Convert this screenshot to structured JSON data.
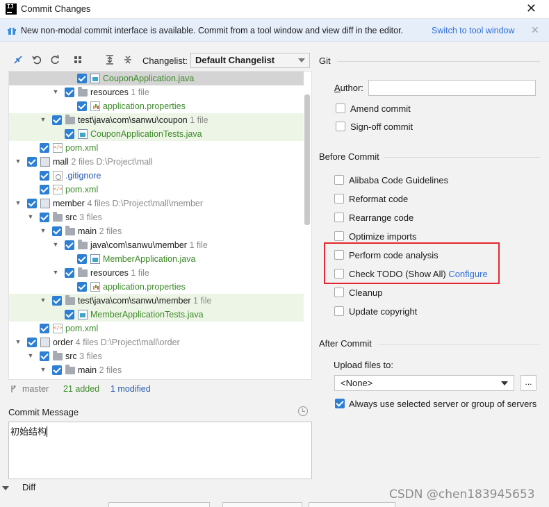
{
  "window": {
    "title": "Commit Changes",
    "logo": "IJ"
  },
  "banner": {
    "text": "New non-modal commit interface is available. Commit from a tool window and view diff in the editor.",
    "link": "Switch to tool window"
  },
  "toolbar": {
    "changelist_label": "Changelist:",
    "changelist_value": "Default Changelist",
    "icons": [
      "diff-arrows-icon",
      "undo-icon",
      "refresh-icon",
      "group-by-icon",
      "expand-all-icon",
      "collapse-all-icon"
    ]
  },
  "tree": [
    {
      "name": "CouponApplication.java",
      "meta": "",
      "type": "java",
      "color": "green"
    },
    {
      "name": "resources",
      "meta": "1 file",
      "type": "folder",
      "color": "normal"
    },
    {
      "name": "application.properties",
      "meta": "",
      "type": "props",
      "color": "green"
    },
    {
      "name": "test\\java\\com\\sanwu\\coupon",
      "meta": "1 file",
      "type": "folder",
      "color": "normal"
    },
    {
      "name": "CouponApplicationTests.java",
      "meta": "",
      "type": "java",
      "color": "green"
    },
    {
      "name": "pom.xml",
      "meta": "",
      "type": "xml",
      "color": "green"
    },
    {
      "name": "mall",
      "meta": "2 files  D:\\Project\\mall",
      "type": "module",
      "color": "normal"
    },
    {
      "name": ".gitignore",
      "meta": "",
      "type": "git",
      "color": "blue"
    },
    {
      "name": "pom.xml",
      "meta": "",
      "type": "xml",
      "color": "green"
    },
    {
      "name": "member",
      "meta": "4 files  D:\\Project\\mall\\member",
      "type": "module",
      "color": "normal"
    },
    {
      "name": "src",
      "meta": "3 files",
      "type": "folder",
      "color": "normal"
    },
    {
      "name": "main",
      "meta": "2 files",
      "type": "folder",
      "color": "normal"
    },
    {
      "name": "java\\com\\sanwu\\member",
      "meta": "1 file",
      "type": "folder",
      "color": "normal"
    },
    {
      "name": "MemberApplication.java",
      "meta": "",
      "type": "java",
      "color": "green"
    },
    {
      "name": "resources",
      "meta": "1 file",
      "type": "folder",
      "color": "normal"
    },
    {
      "name": "application.properties",
      "meta": "",
      "type": "props",
      "color": "green"
    },
    {
      "name": "test\\java\\com\\sanwu\\member",
      "meta": "1 file",
      "type": "folder",
      "color": "normal"
    },
    {
      "name": "MemberApplicationTests.java",
      "meta": "",
      "type": "java",
      "color": "green"
    },
    {
      "name": "pom.xml",
      "meta": "",
      "type": "xml",
      "color": "green"
    },
    {
      "name": "order",
      "meta": "4 files  D:\\Project\\mall\\order",
      "type": "module",
      "color": "normal"
    },
    {
      "name": "src",
      "meta": "3 files",
      "type": "folder",
      "color": "normal"
    },
    {
      "name": "main",
      "meta": "2 files",
      "type": "folder",
      "color": "normal"
    }
  ],
  "status": {
    "branch": "master",
    "added": "21 added",
    "modified": "1 modified"
  },
  "commit_message": {
    "label": "Commit Message",
    "value": "初始结构"
  },
  "diff": {
    "label": "Diff"
  },
  "git": {
    "section": "Git",
    "author_label": "Author:",
    "author_value": "",
    "amend": "Amend commit",
    "signoff": "Sign-off commit"
  },
  "before_commit": {
    "section": "Before Commit",
    "options": [
      {
        "label": "Alibaba Code Guidelines",
        "checked": false
      },
      {
        "label": "Reformat code",
        "checked": false
      },
      {
        "label": "Rearrange code",
        "checked": false
      },
      {
        "label": "Optimize imports",
        "checked": false
      },
      {
        "label": "Perform code analysis",
        "checked": false
      },
      {
        "label": "Check TODO (Show All)",
        "checked": false,
        "link": "Configure"
      },
      {
        "label": "Cleanup",
        "checked": false
      },
      {
        "label": "Update copyright",
        "checked": false
      }
    ]
  },
  "after_commit": {
    "section": "After Commit",
    "upload_label": "Upload files to:",
    "upload_value": "<None>",
    "more_button": "...",
    "always_use": "Always use selected server or group of servers",
    "always_use_checked": true
  },
  "watermark": "CSDN @chen183945653",
  "colors": {
    "accent": "#2d7fd3",
    "link": "#2f6fd6",
    "added": "#3d8a2a",
    "highlight_box": "#e2282e"
  }
}
